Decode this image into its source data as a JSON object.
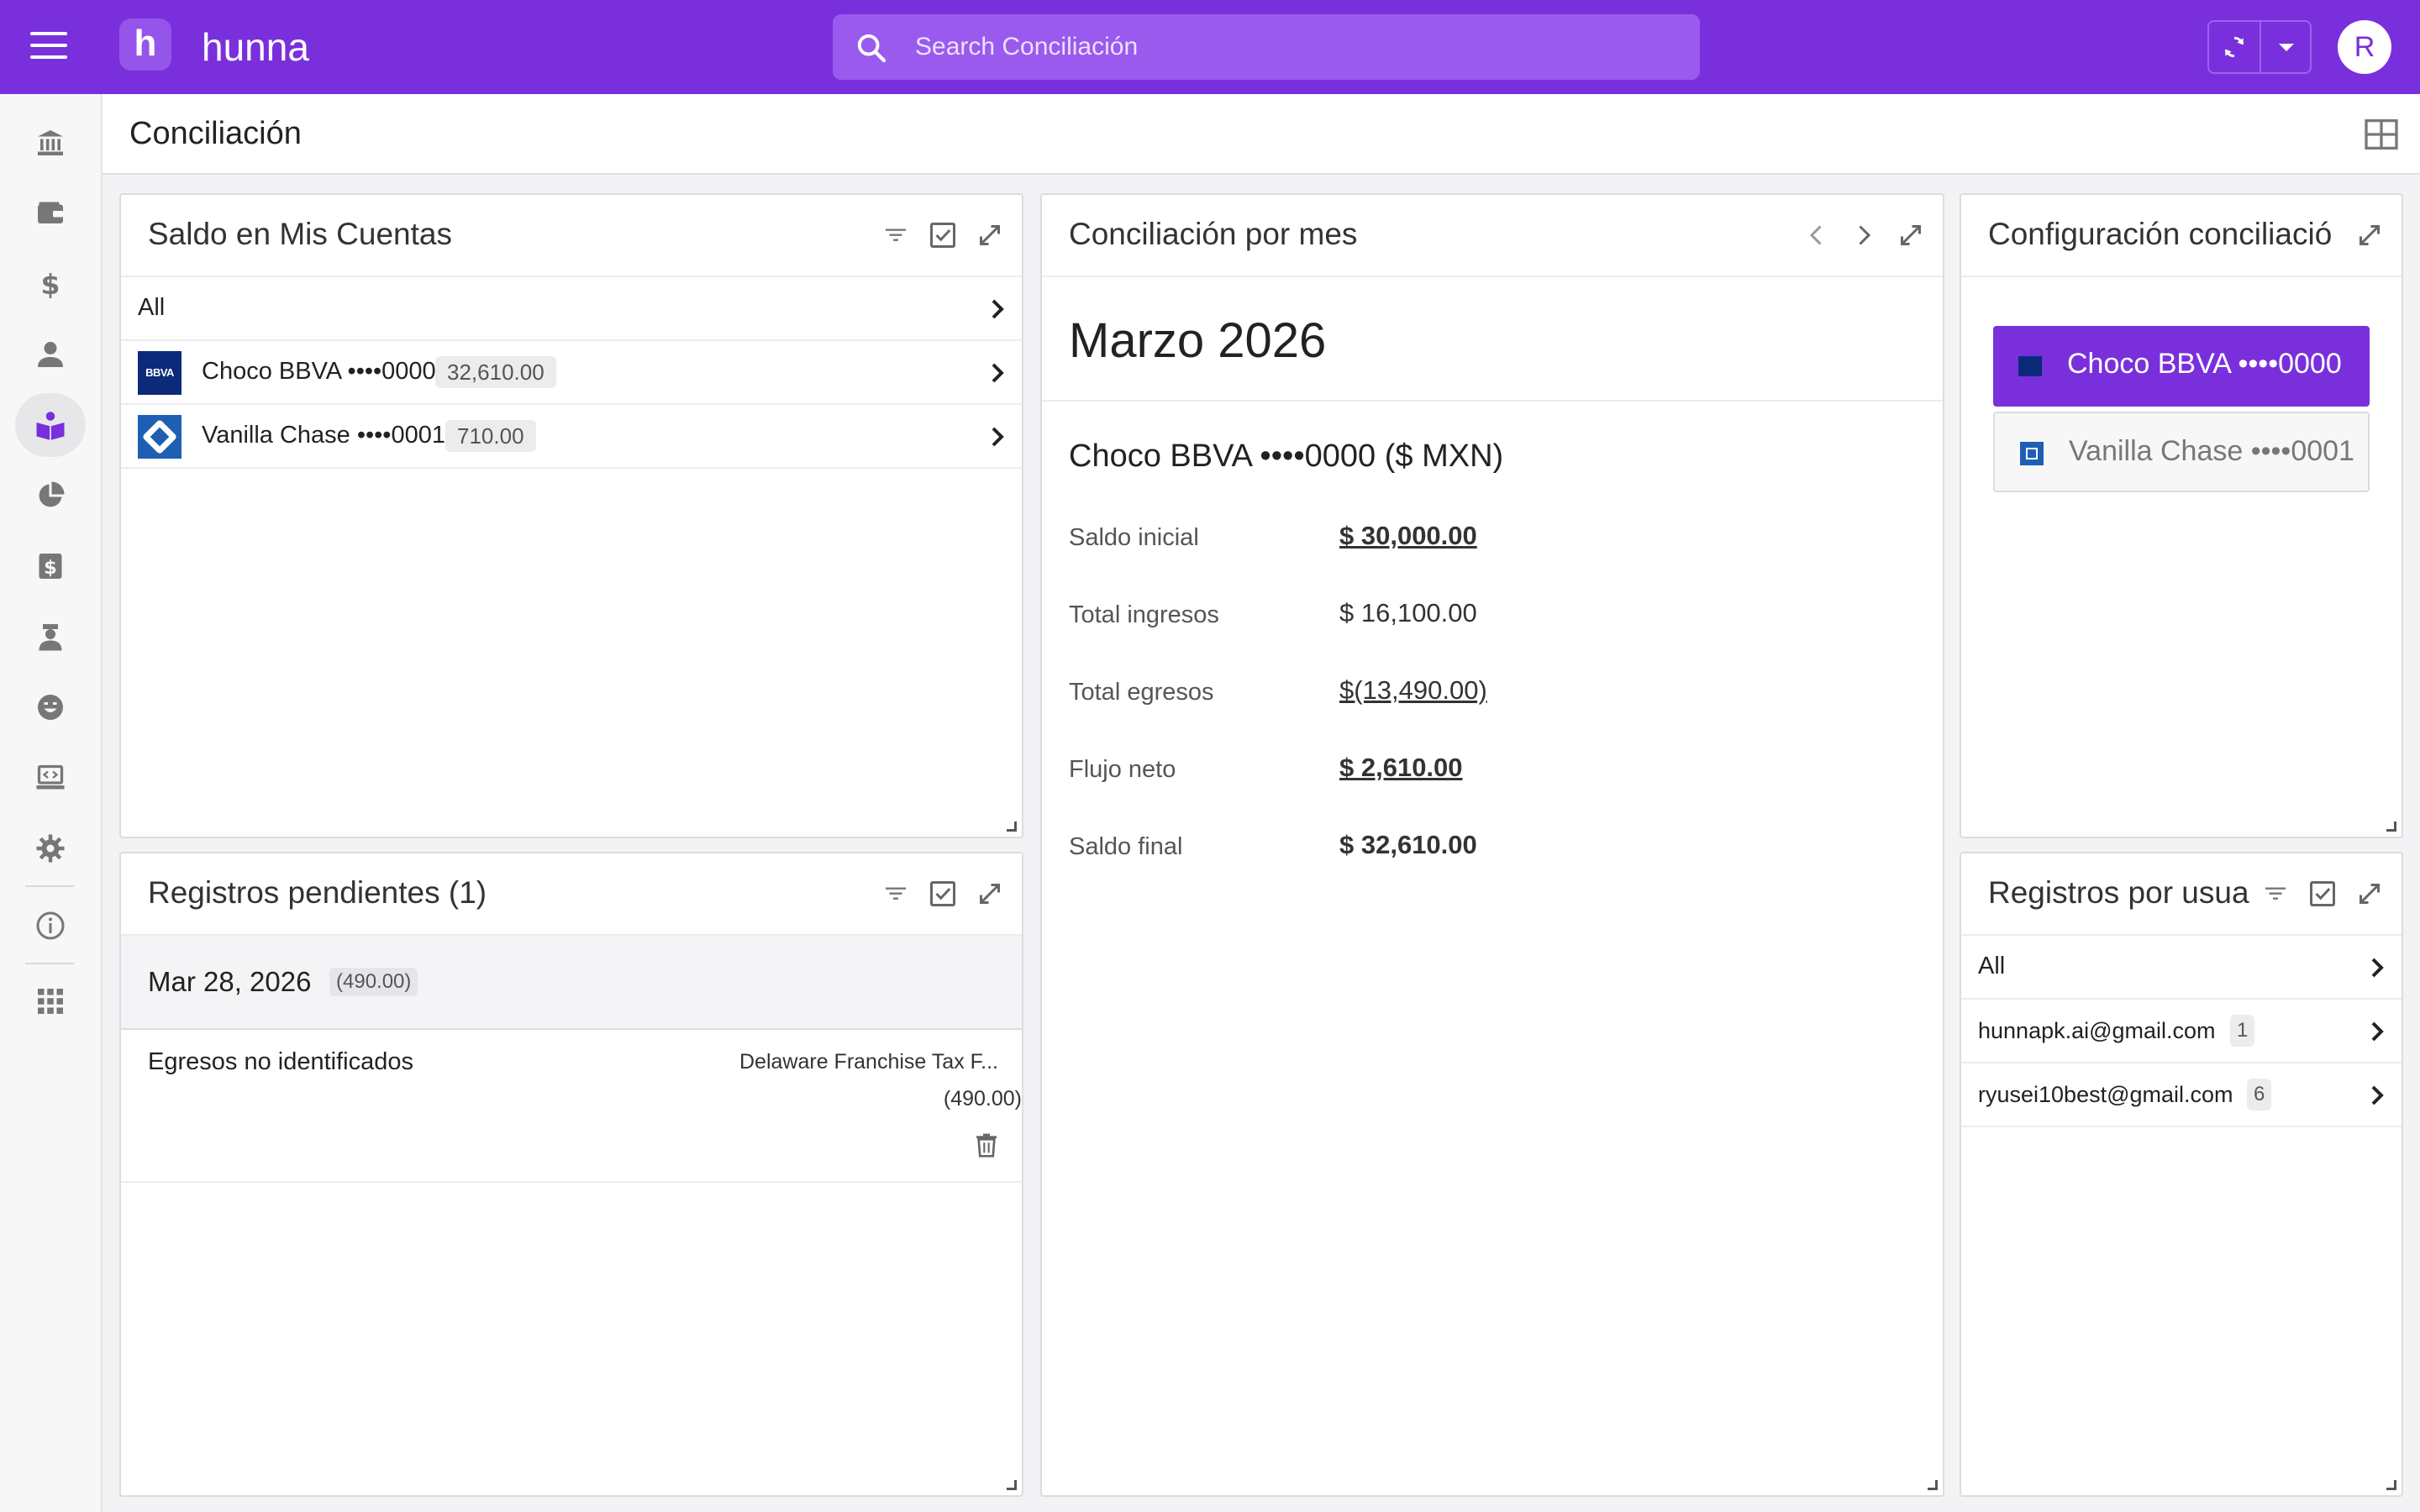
{
  "app": {
    "name": "hunna",
    "logo_letter": "h",
    "accent": "#7a2fdc",
    "avatar_initial": "R"
  },
  "search": {
    "placeholder": "Search Conciliación"
  },
  "rail": [
    {
      "icon": "bank-icon"
    },
    {
      "icon": "wallet-icon"
    },
    {
      "icon": "dollar-icon"
    },
    {
      "icon": "person-icon"
    },
    {
      "icon": "reader-icon",
      "active": true
    },
    {
      "icon": "pie-chart-icon"
    },
    {
      "icon": "money-square-icon"
    },
    {
      "icon": "agent-icon"
    },
    {
      "icon": "smile-icon"
    },
    {
      "icon": "laptop-code-icon"
    },
    {
      "icon": "gear-icon"
    },
    {
      "icon": "info-icon"
    },
    {
      "icon": "apps-grid-icon"
    }
  ],
  "page": {
    "title": "Conciliación"
  },
  "saldo": {
    "title": "Saldo en Mis Cuentas",
    "all_label": "All",
    "accounts": [
      {
        "bank": "BBVA",
        "logo_text": "BBVA",
        "name": "Choco BBVA ••••0000",
        "balance": "32,610.00"
      },
      {
        "bank": "Chase",
        "name": "Vanilla Chase ••••0001",
        "balance": "710.00"
      }
    ]
  },
  "mes": {
    "title": "Conciliación por mes",
    "month": "Marzo 2026",
    "account": "Choco BBVA ••••0000 ($ MXN)",
    "rows": [
      {
        "label": "Saldo inicial",
        "value": "$ 30,000.00"
      },
      {
        "label": "Total ingresos",
        "value": "$ 16,100.00"
      },
      {
        "label": "Total egresos",
        "value": "$(13,490.00)"
      },
      {
        "label": "Flujo neto",
        "value": "$ 2,610.00"
      },
      {
        "label": "Saldo final",
        "value": "$ 32,610.00"
      }
    ]
  },
  "config": {
    "title": "Configuración conciliació",
    "accounts": [
      {
        "name": "Choco BBVA ••••0000",
        "selected": true
      },
      {
        "name": "Vanilla Chase ••••0001",
        "selected": false
      }
    ]
  },
  "pendientes": {
    "title": "Registros pendientes (1)",
    "date": "Mar 28, 2026",
    "date_amount": "(490.00)",
    "item": {
      "category": "Egresos no identificados",
      "description": "Delaware Franchise Tax F...",
      "amount": "(490.00)"
    }
  },
  "usuarios": {
    "title": "Registros por usua",
    "all_label": "All",
    "users": [
      {
        "email": "hunnapk.ai@gmail.com",
        "count": "1"
      },
      {
        "email": "ryusei10best@gmail.com",
        "count": "6"
      }
    ]
  }
}
